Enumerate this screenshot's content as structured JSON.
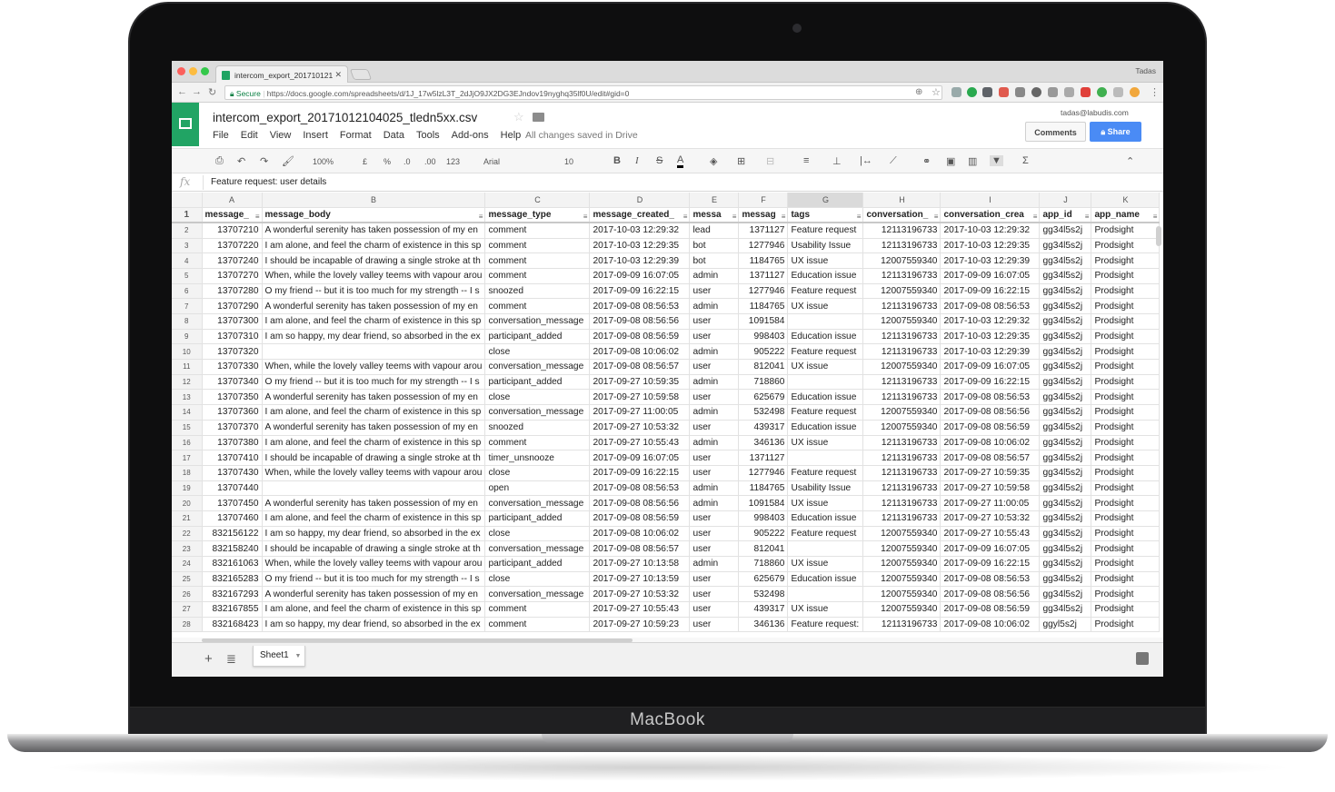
{
  "device_label": "MacBook",
  "browser": {
    "tab_title": "intercom_export_201710121",
    "profile_name": "Tadas",
    "secure_label": "Secure",
    "url": "https://docs.google.com/spreadsheets/d/1J_17w5lzL3T_2dJjO9JX2DG3EJndov19nyghq35lf0U/edit#gid=0"
  },
  "doc": {
    "title": "intercom_export_20171012104025_tledn5xx.csv",
    "menus": [
      "File",
      "Edit",
      "View",
      "Insert",
      "Format",
      "Data",
      "Tools",
      "Add-ons",
      "Help"
    ],
    "save_status": "All changes saved in Drive",
    "account_email": "tadas@labudis.com",
    "comments_label": "Comments",
    "share_label": "Share"
  },
  "toolbar": {
    "zoom": "100%",
    "currency": "£",
    "percent": "%",
    "decimal_less": ".0",
    "decimal_more": ".00",
    "more_formats": "123",
    "font": "Arial",
    "font_size": "10",
    "bold": "B",
    "italic": "I",
    "strike": "S",
    "text_color": "A",
    "functions": "Σ"
  },
  "formula_bar": {
    "fx_label": "fx",
    "value": "Feature request: user details"
  },
  "columns": [
    "A",
    "B",
    "C",
    "D",
    "E",
    "F",
    "G",
    "H",
    "I",
    "J",
    "K"
  ],
  "selected_column": "G",
  "header_row": [
    "message_",
    "message_body",
    "message_type",
    "message_created_",
    "messa",
    "messag",
    "tags",
    "conversation_",
    "conversation_crea",
    "app_id",
    "app_name"
  ],
  "rows": [
    [
      "13707210",
      "A wonderful serenity has taken possession of my en",
      "comment",
      "2017-10-03 12:29:32",
      "lead",
      "1371127",
      "Feature request",
      "12113196733",
      "2017-10-03 12:29:32",
      "gg34l5s2j",
      "Prodsight"
    ],
    [
      "13707220",
      "I am alone, and feel the charm of existence in this sp",
      "comment",
      "2017-10-03 12:29:35",
      "bot",
      "1277946",
      "Usability Issue",
      "12113196733",
      "2017-10-03 12:29:35",
      "gg34l5s2j",
      "Prodsight"
    ],
    [
      "13707240",
      "I should be incapable of drawing a single stroke at th",
      "comment",
      "2017-10-03 12:29:39",
      "bot",
      "1184765",
      "UX issue",
      "12007559340",
      "2017-10-03 12:29:39",
      "gg34l5s2j",
      "Prodsight"
    ],
    [
      "13707270",
      "When, while the lovely valley teems with vapour arou",
      "comment",
      "2017-09-09 16:07:05",
      "admin",
      "1371127",
      "Education issue",
      "12113196733",
      "2017-09-09 16:07:05",
      "gg34l5s2j",
      "Prodsight"
    ],
    [
      "13707280",
      "O my friend -- but it is too much for my strength -- I s",
      "snoozed",
      "2017-09-09 16:22:15",
      "user",
      "1277946",
      "Feature request",
      "12007559340",
      "2017-09-09 16:22:15",
      "gg34l5s2j",
      "Prodsight"
    ],
    [
      "13707290",
      "A wonderful serenity has taken possession of my en",
      "comment",
      "2017-09-08 08:56:53",
      "admin",
      "1184765",
      "UX issue",
      "12113196733",
      "2017-09-08 08:56:53",
      "gg34l5s2j",
      "Prodsight"
    ],
    [
      "13707300",
      "I am alone, and feel the charm of existence in this sp",
      "conversation_message",
      "2017-09-08 08:56:56",
      "user",
      "1091584",
      "",
      "12007559340",
      "2017-10-03 12:29:32",
      "gg34l5s2j",
      "Prodsight"
    ],
    [
      "13707310",
      "I am so happy, my dear friend, so absorbed in the ex",
      "participant_added",
      "2017-09-08 08:56:59",
      "user",
      "998403",
      "Education issue",
      "12113196733",
      "2017-10-03 12:29:35",
      "gg34l5s2j",
      "Prodsight"
    ],
    [
      "13707320",
      "",
      "close",
      "2017-09-08 10:06:02",
      "admin",
      "905222",
      "Feature request",
      "12113196733",
      "2017-10-03 12:29:39",
      "gg34l5s2j",
      "Prodsight"
    ],
    [
      "13707330",
      "When, while the lovely valley teems with vapour arou",
      "conversation_message",
      "2017-09-08 08:56:57",
      "user",
      "812041",
      "UX issue",
      "12007559340",
      "2017-09-09 16:07:05",
      "gg34l5s2j",
      "Prodsight"
    ],
    [
      "13707340",
      "O my friend -- but it is too much for my strength -- I s",
      "participant_added",
      "2017-09-27 10:59:35",
      "admin",
      "718860",
      "",
      "12113196733",
      "2017-09-09 16:22:15",
      "gg34l5s2j",
      "Prodsight"
    ],
    [
      "13707350",
      "A wonderful serenity has taken possession of my en",
      "close",
      "2017-09-27 10:59:58",
      "user",
      "625679",
      "Education issue",
      "12113196733",
      "2017-09-08 08:56:53",
      "gg34l5s2j",
      "Prodsight"
    ],
    [
      "13707360",
      "I am alone, and feel the charm of existence in this sp",
      "conversation_message",
      "2017-09-27 11:00:05",
      "admin",
      "532498",
      "Feature request",
      "12007559340",
      "2017-09-08 08:56:56",
      "gg34l5s2j",
      "Prodsight"
    ],
    [
      "13707370",
      "A wonderful serenity has taken possession of my en",
      "snoozed",
      "2017-09-27 10:53:32",
      "user",
      "439317",
      "Education issue",
      "12007559340",
      "2017-09-08 08:56:59",
      "gg34l5s2j",
      "Prodsight"
    ],
    [
      "13707380",
      "I am alone, and feel the charm of existence in this sp",
      "comment",
      "2017-09-27 10:55:43",
      "admin",
      "346136",
      "UX issue",
      "12113196733",
      "2017-09-08 10:06:02",
      "gg34l5s2j",
      "Prodsight"
    ],
    [
      "13707410",
      "I should be incapable of drawing a single stroke at th",
      "timer_unsnooze",
      "2017-09-09 16:07:05",
      "user",
      "1371127",
      "",
      "12113196733",
      "2017-09-08 08:56:57",
      "gg34l5s2j",
      "Prodsight"
    ],
    [
      "13707430",
      "When, while the lovely valley teems with vapour arou",
      "close",
      "2017-09-09 16:22:15",
      "user",
      "1277946",
      "Feature request",
      "12113196733",
      "2017-09-27 10:59:35",
      "gg34l5s2j",
      "Prodsight"
    ],
    [
      "13707440",
      "",
      "open",
      "2017-09-08 08:56:53",
      "admin",
      "1184765",
      "Usability Issue",
      "12113196733",
      "2017-09-27 10:59:58",
      "gg34l5s2j",
      "Prodsight"
    ],
    [
      "13707450",
      "A wonderful serenity has taken possession of my en",
      "conversation_message",
      "2017-09-08 08:56:56",
      "admin",
      "1091584",
      "UX issue",
      "12113196733",
      "2017-09-27 11:00:05",
      "gg34l5s2j",
      "Prodsight"
    ],
    [
      "13707460",
      "I am alone, and feel the charm of existence in this sp",
      "participant_added",
      "2017-09-08 08:56:59",
      "user",
      "998403",
      "Education issue",
      "12113196733",
      "2017-09-27 10:53:32",
      "gg34l5s2j",
      "Prodsight"
    ],
    [
      "832156122",
      "I am so happy, my dear friend, so absorbed in the ex",
      "close",
      "2017-09-08 10:06:02",
      "user",
      "905222",
      "Feature request",
      "12007559340",
      "2017-09-27 10:55:43",
      "gg34l5s2j",
      "Prodsight"
    ],
    [
      "832158240",
      "I should be incapable of drawing a single stroke at th",
      "conversation_message",
      "2017-09-08 08:56:57",
      "user",
      "812041",
      "",
      "12007559340",
      "2017-09-09 16:07:05",
      "gg34l5s2j",
      "Prodsight"
    ],
    [
      "832161063",
      "When, while the lovely valley teems with vapour arou",
      "participant_added",
      "2017-09-27 10:13:58",
      "admin",
      "718860",
      "UX issue",
      "12007559340",
      "2017-09-09 16:22:15",
      "gg34l5s2j",
      "Prodsight"
    ],
    [
      "832165283",
      "O my friend -- but it is too much for my strength -- I s",
      "close",
      "2017-09-27 10:13:59",
      "user",
      "625679",
      "Education issue",
      "12007559340",
      "2017-09-08 08:56:53",
      "gg34l5s2j",
      "Prodsight"
    ],
    [
      "832167293",
      "A wonderful serenity has taken possession of my en",
      "conversation_message",
      "2017-09-27 10:53:32",
      "user",
      "532498",
      "",
      "12007559340",
      "2017-09-08 08:56:56",
      "gg34l5s2j",
      "Prodsight"
    ],
    [
      "832167855",
      "I am alone, and feel the charm of existence in this sp",
      "comment",
      "2017-09-27 10:55:43",
      "user",
      "439317",
      "UX issue",
      "12007559340",
      "2017-09-08 08:56:59",
      "gg34l5s2j",
      "Prodsight"
    ],
    [
      "832168423",
      "I am so happy, my dear friend, so absorbed in the ex",
      "comment",
      "2017-09-27 10:59:23",
      "user",
      "346136",
      "Feature request:",
      "12113196733",
      "2017-09-08 10:06:02",
      "ggyl5s2j",
      "Prodsight"
    ]
  ],
  "sheet_tab": "Sheet1",
  "colors": {
    "sheets_green": "#21a464",
    "share_blue": "#4a8bf5",
    "selected_header": "#dadada"
  }
}
